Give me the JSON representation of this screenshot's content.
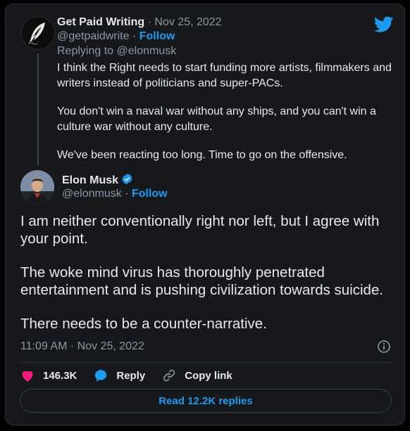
{
  "colors": {
    "accent": "#1d9bf0",
    "like": "#f91880",
    "background": "#16181c",
    "text": "#e7e9ea",
    "muted": "#8b98a5"
  },
  "quoted": {
    "name": "Get Paid Writing",
    "sep_date": "·",
    "date": "Nov 25, 2022",
    "handle": "@getpaidwrite",
    "sep_follow": "·",
    "follow": "Follow",
    "replying_to_prefix": "Replying to",
    "replying_to": "@elonmusk",
    "avatar_icon": "quill-icon",
    "paragraphs": [
      "I think the Right needs to start funding more artists, filmmakers and writers instead of politicians and super-PACs.",
      "You don't win a naval war without any ships, and you can't win a culture war without any culture.",
      "We've been reacting too long. Time to go on the offensive."
    ]
  },
  "main": {
    "name": "Elon Musk",
    "verified_icon": "verified-badge-icon",
    "handle": "@elonmusk",
    "sep_follow": "·",
    "follow": "Follow",
    "paragraphs": [
      "I am neither conventionally right nor left, but I agree with your point.",
      "The woke mind virus has thoroughly penetrated entertainment and is pushing civilization towards suicide.",
      "There needs to be a counter-narrative."
    ],
    "time": "11:09 AM",
    "sep_date": "·",
    "date": "Nov 25, 2022"
  },
  "actions": {
    "likes": "146.3K",
    "reply": "Reply",
    "copy_link": "Copy link",
    "read_replies": "Read 12.2K replies"
  },
  "icons": [
    "twitter-bird-icon",
    "heart-icon",
    "reply-bubble-icon",
    "link-icon",
    "info-icon"
  ]
}
